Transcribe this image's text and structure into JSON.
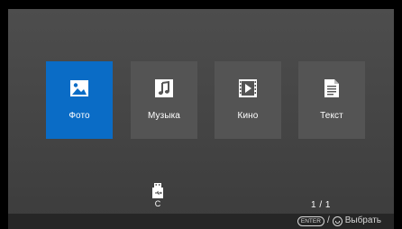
{
  "menu": {
    "tiles": [
      {
        "id": "photo",
        "label": "Фото",
        "icon": "photo-icon",
        "selected": true
      },
      {
        "id": "music",
        "label": "Музыка",
        "icon": "music-note-icon",
        "selected": false
      },
      {
        "id": "movie",
        "label": "Кино",
        "icon": "film-play-icon",
        "selected": false
      },
      {
        "id": "text",
        "label": "Текст",
        "icon": "document-icon",
        "selected": false
      }
    ]
  },
  "device": {
    "icon": "usb-drive-icon",
    "label": "C"
  },
  "pagination": {
    "text": "1 / 1"
  },
  "footer": {
    "enter_key": "ENTER",
    "separator": "/",
    "ok_icon": "ok-button-icon",
    "action_label": "Выбрать"
  },
  "colors": {
    "selected_tile": "#0a6cc6",
    "tile": "#545454",
    "background": "#474747",
    "footer_bar": "#262626"
  }
}
